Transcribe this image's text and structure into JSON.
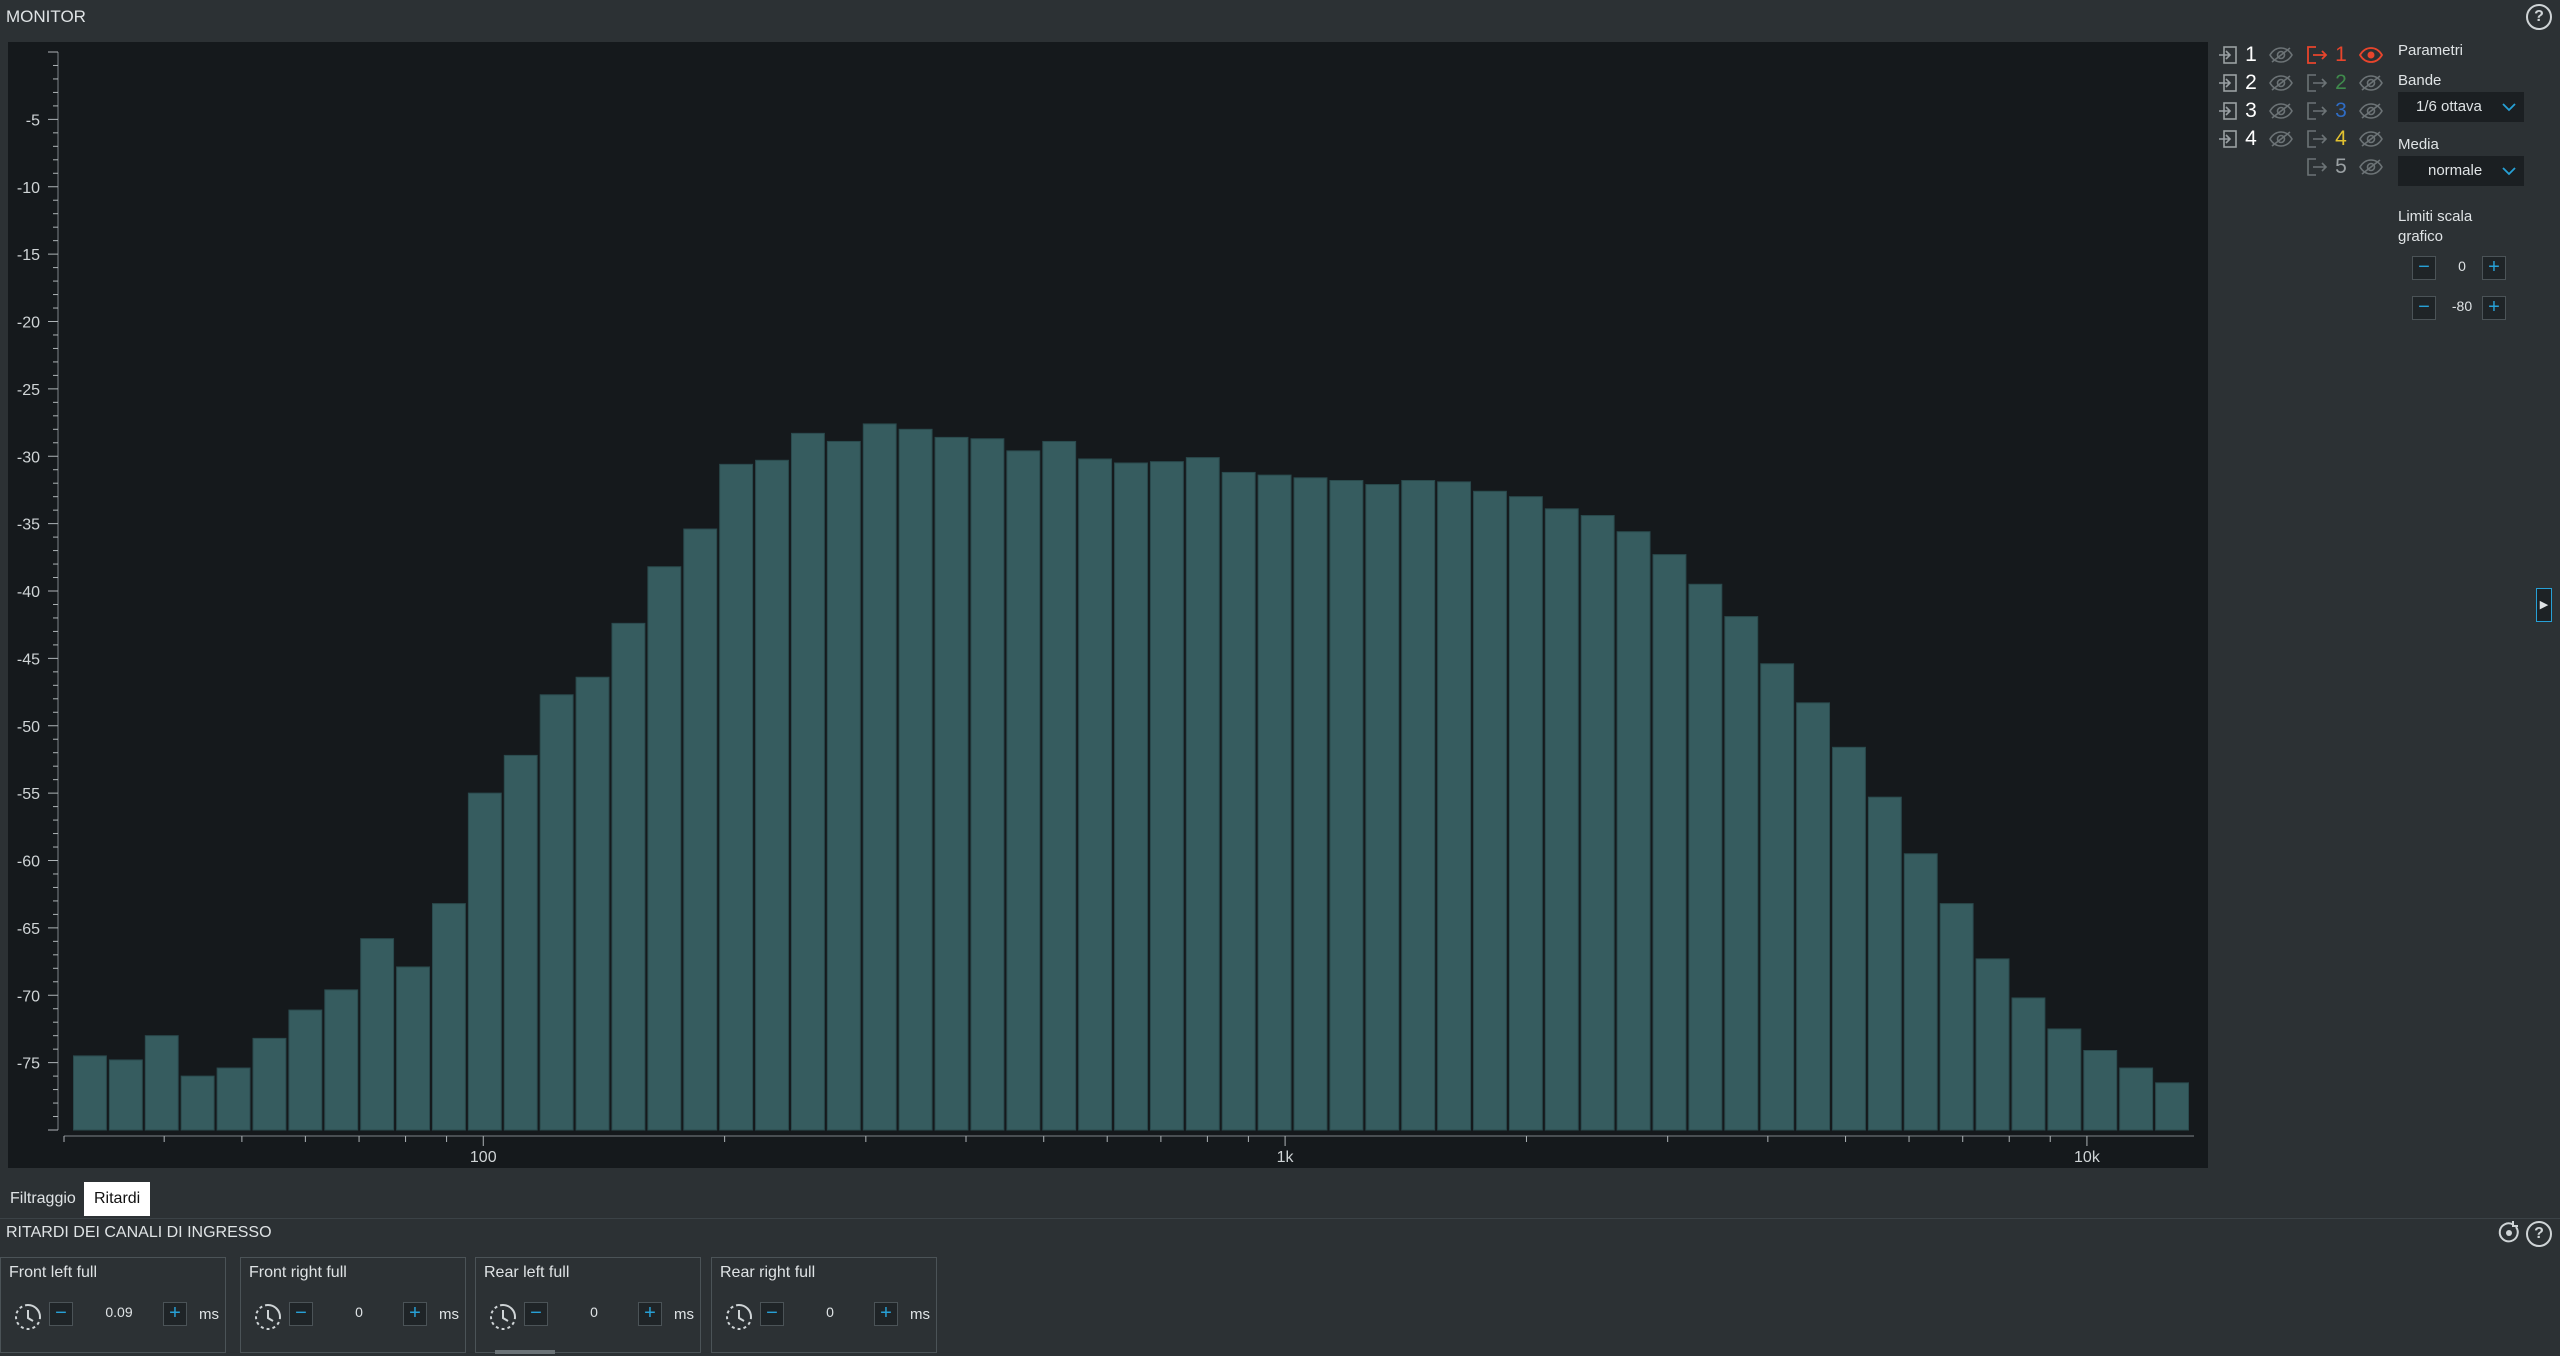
{
  "window": {
    "title": "MONITOR"
  },
  "colors": {
    "bar": "#365c5f",
    "bar_edge": "#2a4a4d",
    "plot_bg": "#15191c",
    "accent": "#27a0d6",
    "out1": "#e8452c",
    "out2": "#3f8a4c",
    "out3": "#2f6cc4",
    "out4": "#e3c230",
    "out5": "#9aa0a3"
  },
  "chart_data": {
    "type": "bar",
    "title": "",
    "xlabel": "",
    "ylabel": "",
    "x_scale": "log",
    "xlim": [
      30,
      13600
    ],
    "ylim": [
      -80,
      0
    ],
    "y_ticks": [
      -5,
      -10,
      -15,
      -20,
      -25,
      -30,
      -35,
      -40,
      -45,
      -50,
      -55,
      -60,
      -65,
      -70,
      -75
    ],
    "x_tick_labels": [
      {
        "value": 100,
        "label": "100"
      },
      {
        "value": 1000,
        "label": "1k"
      },
      {
        "value": 10000,
        "label": "10k"
      }
    ],
    "bands": "1/6 octave",
    "values": [
      -74.5,
      -74.8,
      -73.0,
      -76.0,
      -75.4,
      -73.2,
      -71.1,
      -69.6,
      -65.8,
      -67.9,
      -63.2,
      -55.0,
      -52.2,
      -47.7,
      -46.4,
      -42.4,
      -38.2,
      -35.4,
      -30.6,
      -30.3,
      -28.3,
      -28.9,
      -27.6,
      -28.0,
      -28.6,
      -28.7,
      -29.6,
      -28.9,
      -30.2,
      -30.5,
      -30.4,
      -30.1,
      -31.2,
      -31.4,
      -31.6,
      -31.8,
      -32.1,
      -31.8,
      -31.9,
      -32.6,
      -33.0,
      -33.9,
      -34.4,
      -35.6,
      -37.3,
      -39.5,
      -41.9,
      -45.4,
      -48.3,
      -51.6,
      -55.3,
      -59.5,
      -63.2,
      -67.3,
      -70.2,
      -72.5,
      -74.1,
      -75.4,
      -76.5
    ]
  },
  "inputs": [
    {
      "label": "1"
    },
    {
      "label": "2"
    },
    {
      "label": "3"
    },
    {
      "label": "4"
    }
  ],
  "outputs": [
    {
      "label": "1",
      "color": "#e8452c",
      "visible": true
    },
    {
      "label": "2",
      "color": "#3f8a4c",
      "visible": false
    },
    {
      "label": "3",
      "color": "#2f6cc4",
      "visible": false
    },
    {
      "label": "4",
      "color": "#e3c230",
      "visible": false
    },
    {
      "label": "5",
      "color": "#9aa0a3",
      "visible": false
    }
  ],
  "params": {
    "heading": "Parametri",
    "bands_label": "Bande",
    "bands_value": "1/6 ottava",
    "media_label": "Media",
    "media_value": "normale",
    "scale_label_1": "Limiti scala",
    "scale_label_2": "grafico",
    "scale_max": "0",
    "scale_min": "-80"
  },
  "tabs": [
    {
      "label": "Filtraggio",
      "active": false
    },
    {
      "label": "Ritardi",
      "active": true
    }
  ],
  "delays": {
    "section_title": "RITARDI DEI CANALI DI INGRESSO",
    "unit": "ms",
    "channels": [
      {
        "name": "Front left full",
        "value": "0.09"
      },
      {
        "name": "Front right full",
        "value": "0"
      },
      {
        "name": "Rear left full",
        "value": "0"
      },
      {
        "name": "Rear right full",
        "value": "0"
      }
    ]
  }
}
